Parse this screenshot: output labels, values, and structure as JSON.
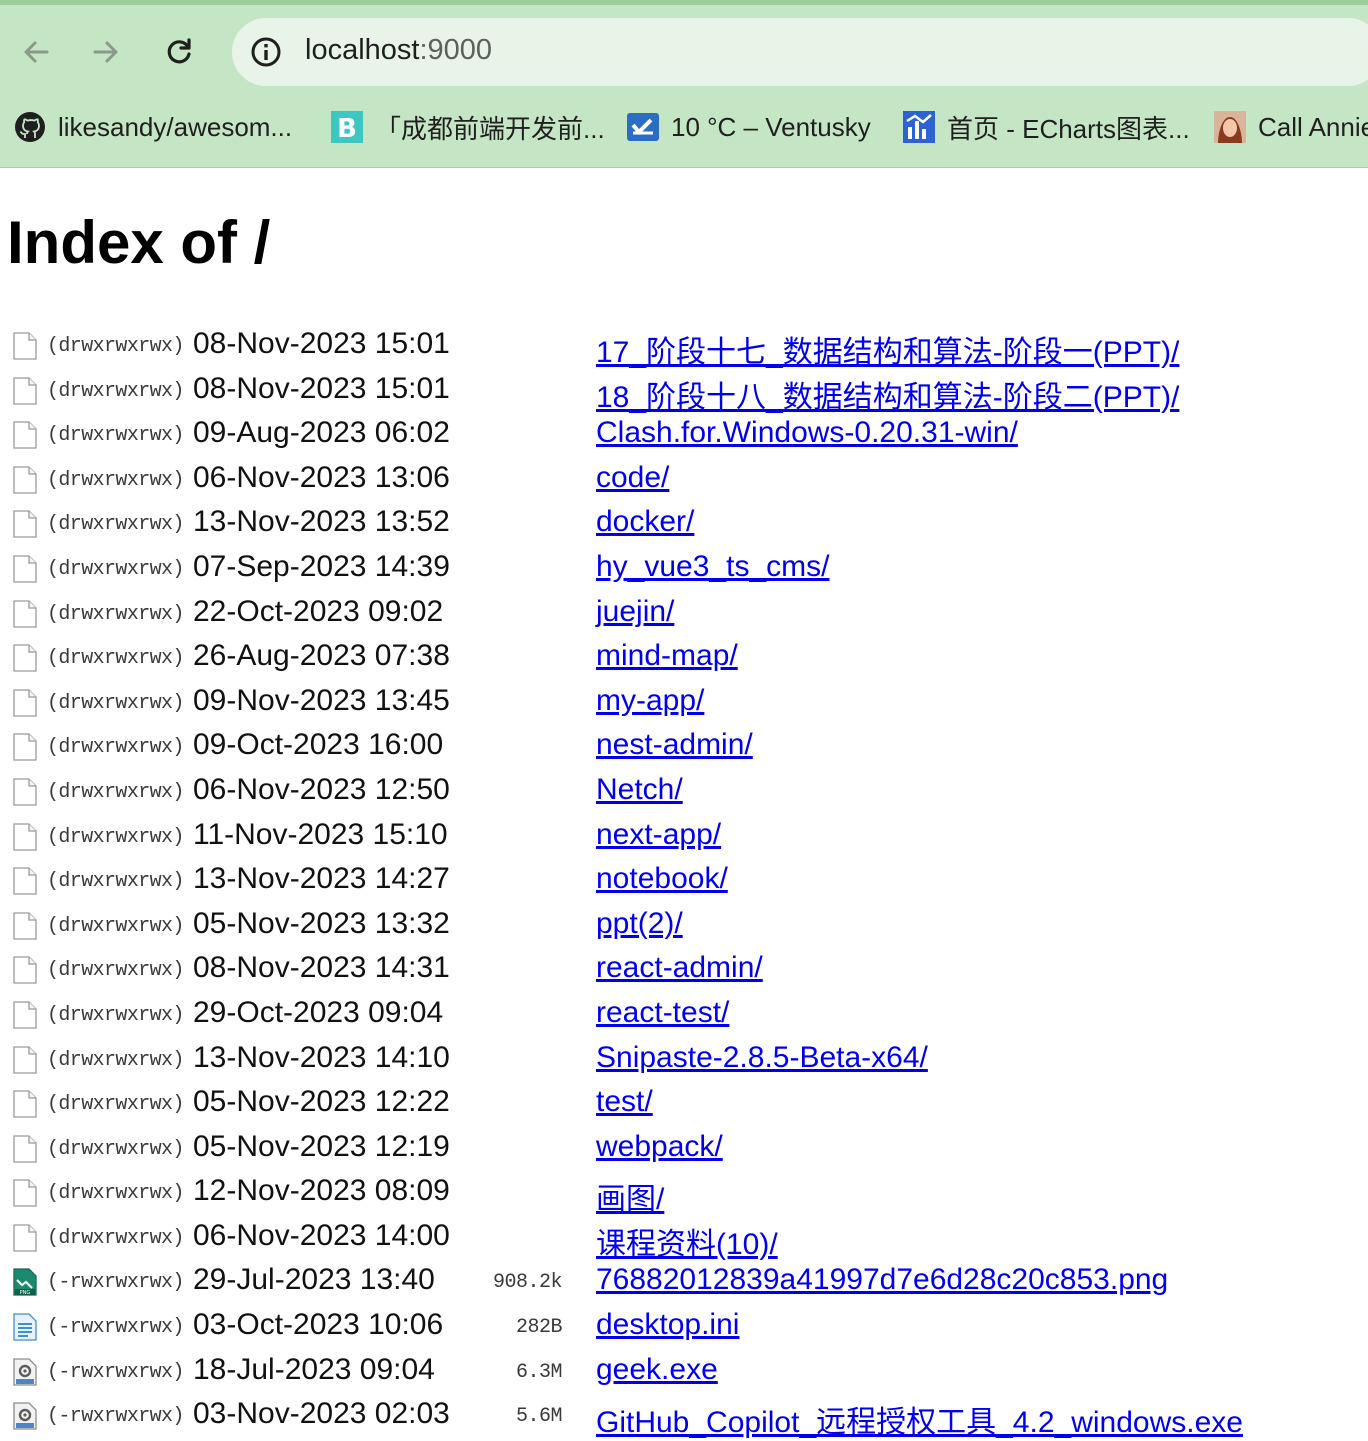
{
  "browser": {
    "url_host": "localhost",
    "url_port": ":9000",
    "bookmarks": [
      {
        "label": "likesandy/awesom...",
        "icon": "github-icon"
      },
      {
        "label": "「成都前端开发前...",
        "icon": "b-logo-icon"
      },
      {
        "label": "10 °C – Ventusky",
        "icon": "ventusky-icon"
      },
      {
        "label": "首页 - ECharts图表...",
        "icon": "echarts-icon"
      },
      {
        "label": "Call Annie",
        "icon": "avatar-icon"
      }
    ]
  },
  "page": {
    "title": "Index of /",
    "entries": [
      {
        "perm": "(drwxrwxrwx)",
        "date": "08-Nov-2023 15:01",
        "size": "",
        "name": "17_阶段十七_数据结构和算法-阶段一(PPT)/",
        "type": "dir"
      },
      {
        "perm": "(drwxrwxrwx)",
        "date": "08-Nov-2023 15:01",
        "size": "",
        "name": "18_阶段十八_数据结构和算法-阶段二(PPT)/",
        "type": "dir"
      },
      {
        "perm": "(drwxrwxrwx)",
        "date": "09-Aug-2023 06:02",
        "size": "",
        "name": "Clash.for.Windows-0.20.31-win/",
        "type": "dir"
      },
      {
        "perm": "(drwxrwxrwx)",
        "date": "06-Nov-2023 13:06",
        "size": "",
        "name": "code/",
        "type": "dir"
      },
      {
        "perm": "(drwxrwxrwx)",
        "date": "13-Nov-2023 13:52",
        "size": "",
        "name": "docker/",
        "type": "dir"
      },
      {
        "perm": "(drwxrwxrwx)",
        "date": "07-Sep-2023 14:39",
        "size": "",
        "name": "hy_vue3_ts_cms/",
        "type": "dir"
      },
      {
        "perm": "(drwxrwxrwx)",
        "date": "22-Oct-2023 09:02",
        "size": "",
        "name": "juejin/",
        "type": "dir"
      },
      {
        "perm": "(drwxrwxrwx)",
        "date": "26-Aug-2023 07:38",
        "size": "",
        "name": "mind-map/",
        "type": "dir"
      },
      {
        "perm": "(drwxrwxrwx)",
        "date": "09-Nov-2023 13:45",
        "size": "",
        "name": "my-app/",
        "type": "dir"
      },
      {
        "perm": "(drwxrwxrwx)",
        "date": "09-Oct-2023 16:00",
        "size": "",
        "name": "nest-admin/",
        "type": "dir"
      },
      {
        "perm": "(drwxrwxrwx)",
        "date": "06-Nov-2023 12:50",
        "size": "",
        "name": "Netch/",
        "type": "dir"
      },
      {
        "perm": "(drwxrwxrwx)",
        "date": "11-Nov-2023 15:10",
        "size": "",
        "name": "next-app/",
        "type": "dir"
      },
      {
        "perm": "(drwxrwxrwx)",
        "date": "13-Nov-2023 14:27",
        "size": "",
        "name": "notebook/",
        "type": "dir"
      },
      {
        "perm": "(drwxrwxrwx)",
        "date": "05-Nov-2023 13:32",
        "size": "",
        "name": "ppt(2)/",
        "type": "dir"
      },
      {
        "perm": "(drwxrwxrwx)",
        "date": "08-Nov-2023 14:31",
        "size": "",
        "name": "react-admin/",
        "type": "dir"
      },
      {
        "perm": "(drwxrwxrwx)",
        "date": "29-Oct-2023 09:04",
        "size": "",
        "name": "react-test/",
        "type": "dir"
      },
      {
        "perm": "(drwxrwxrwx)",
        "date": "13-Nov-2023 14:10",
        "size": "",
        "name": "Snipaste-2.8.5-Beta-x64/",
        "type": "dir"
      },
      {
        "perm": "(drwxrwxrwx)",
        "date": "05-Nov-2023 12:22",
        "size": "",
        "name": "test/",
        "type": "dir"
      },
      {
        "perm": "(drwxrwxrwx)",
        "date": "05-Nov-2023 12:19",
        "size": "",
        "name": "webpack/",
        "type": "dir"
      },
      {
        "perm": "(drwxrwxrwx)",
        "date": "12-Nov-2023 08:09",
        "size": "",
        "name": "画图/",
        "type": "dir"
      },
      {
        "perm": "(drwxrwxrwx)",
        "date": "06-Nov-2023 14:00",
        "size": "",
        "name": "课程资料(10)/",
        "type": "dir"
      },
      {
        "perm": "(-rwxrwxrwx)",
        "date": "29-Jul-2023 13:40",
        "size": "908.2k",
        "name": "76882012839a41997d7e6d28c20c853.png",
        "type": "png"
      },
      {
        "perm": "(-rwxrwxrwx)",
        "date": "03-Oct-2023 10:06",
        "size": "282B",
        "name": "desktop.ini",
        "type": "ini"
      },
      {
        "perm": "(-rwxrwxrwx)",
        "date": "18-Jul-2023 09:04",
        "size": "6.3M",
        "name": "geek.exe",
        "type": "exe"
      },
      {
        "perm": "(-rwxrwxrwx)",
        "date": "03-Nov-2023 02:03",
        "size": "5.6M",
        "name": "GitHub_Copilot_远程授权工具_4.2_windows.exe",
        "type": "exe"
      }
    ]
  }
}
